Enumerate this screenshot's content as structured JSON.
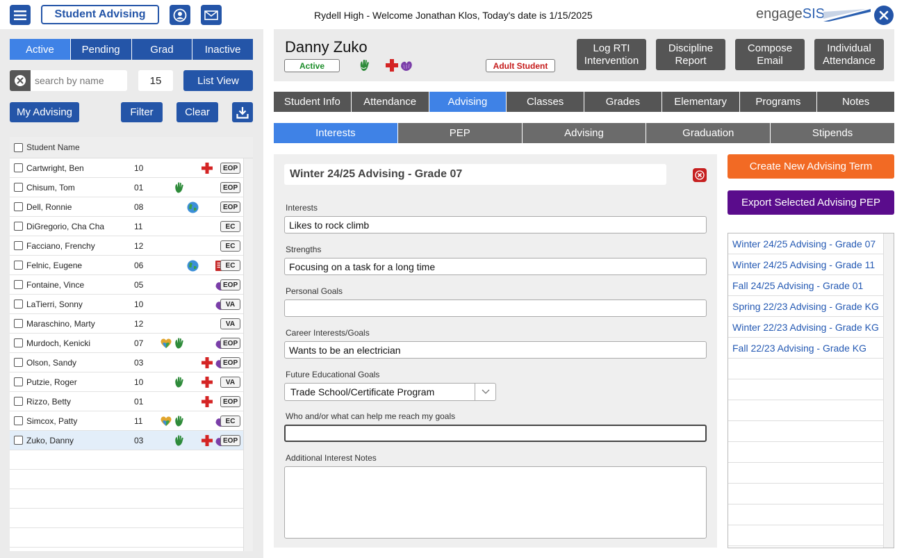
{
  "header": {
    "app_button": "Student Advising",
    "welcome": "Rydell High - Welcome Jonathan Klos, Today's date is 1/15/2025",
    "logo_engage": "engage",
    "logo_sis": "SIS"
  },
  "left": {
    "status_tabs": [
      "Active",
      "Pending",
      "Grad",
      "Inactive"
    ],
    "search_placeholder": "search by name",
    "count": "15",
    "list_view": "List View",
    "my_advising": "My Advising",
    "filter": "Filter",
    "clear": "Clear",
    "column_header": "Student Name",
    "students": [
      {
        "name": "Cartwright, Ben",
        "grade": "10",
        "badge": "EOP",
        "icons": [
          "medical"
        ]
      },
      {
        "name": "Chisum, Tom",
        "grade": "01",
        "badge": "EOP",
        "icons": [
          "green-hand"
        ]
      },
      {
        "name": "Dell, Ronnie",
        "grade": "08",
        "badge": "EOP",
        "icons": [
          "globe"
        ]
      },
      {
        "name": "DiGregorio, Cha Cha",
        "grade": "11",
        "badge": "EC",
        "icons": []
      },
      {
        "name": "Facciano, Frenchy",
        "grade": "12",
        "badge": "EC",
        "icons": []
      },
      {
        "name": "Felnic, Eugene",
        "grade": "06",
        "badge": "EC",
        "icons": [
          "globe",
          "document"
        ]
      },
      {
        "name": "Fontaine, Vince",
        "grade": "05",
        "badge": "EOP",
        "icons": [
          "purple-hands"
        ]
      },
      {
        "name": "LaTierri, Sonny",
        "grade": "10",
        "badge": "VA",
        "icons": [
          "purple-hands"
        ]
      },
      {
        "name": "Maraschino, Marty",
        "grade": "12",
        "badge": "VA",
        "icons": []
      },
      {
        "name": "Murdoch, Kenicki",
        "grade": "07",
        "badge": "EOP",
        "icons": [
          "heart",
          "green-hand",
          "purple-hands"
        ]
      },
      {
        "name": "Olson, Sandy",
        "grade": "03",
        "badge": "EOP",
        "icons": [
          "medical",
          "purple-hands"
        ]
      },
      {
        "name": "Putzie, Roger",
        "grade": "10",
        "badge": "VA",
        "icons": [
          "green-hand",
          "medical"
        ]
      },
      {
        "name": "Rizzo, Betty",
        "grade": "01",
        "badge": "EOP",
        "icons": [
          "medical"
        ]
      },
      {
        "name": "Simcox, Patty",
        "grade": "11",
        "badge": "EC",
        "icons": [
          "heart",
          "green-hand",
          "purple-hands"
        ]
      },
      {
        "name": "Zuko, Danny",
        "grade": "03",
        "badge": "EOP",
        "icons": [
          "green-hand",
          "medical",
          "purple-hands"
        ],
        "selected": true
      }
    ]
  },
  "student": {
    "name": "Danny Zuko",
    "status": "Active",
    "adult": "Adult Student",
    "actions": [
      "Log RTI\nIntervention",
      "Discipline\nReport",
      "Compose\nEmail",
      "Individual\nAttendance"
    ]
  },
  "tabs": [
    "Student Info",
    "Attendance",
    "Advising",
    "Classes",
    "Grades",
    "Elementary",
    "Programs",
    "Notes"
  ],
  "subtabs": [
    "Interests",
    "PEP",
    "Advising",
    "Graduation",
    "Stipends"
  ],
  "form": {
    "term_title": "Winter 24/25 Advising - Grade 07",
    "interests_label": "Interests",
    "interests": "Likes to rock climb",
    "strengths_label": "Strengths",
    "strengths": "Focusing on a task for a long time",
    "personal_goals_label": "Personal Goals",
    "personal_goals": "",
    "career_label": "Career Interests/Goals",
    "career": "Wants to be an electrician",
    "future_label": "Future Educational Goals",
    "future": "Trade School/Certificate Program",
    "help_label": "Who and/or what can help me reach my goals",
    "help": "",
    "notes_label": "Additional Interest Notes"
  },
  "right": {
    "create_term": "Create New Advising Term",
    "export_pep": "Export Selected Advising PEP",
    "terms": [
      "Winter 24/25 Advising - Grade 07",
      "Winter 24/25 Advising - Grade 11",
      "Fall 24/25 Advising - Grade 01",
      "Spring 22/23 Advising - Grade KG",
      "Winter 22/23 Advising - Grade KG",
      "Fall 22/23 Advising - Grade KG"
    ]
  },
  "colors": {
    "primary": "#2455a8",
    "selected_tab": "#3f82e6",
    "orange": "#f26a24",
    "purple": "#5a0c8c",
    "active_green": "#1c8d2a",
    "adult_red": "#c51a1a"
  }
}
